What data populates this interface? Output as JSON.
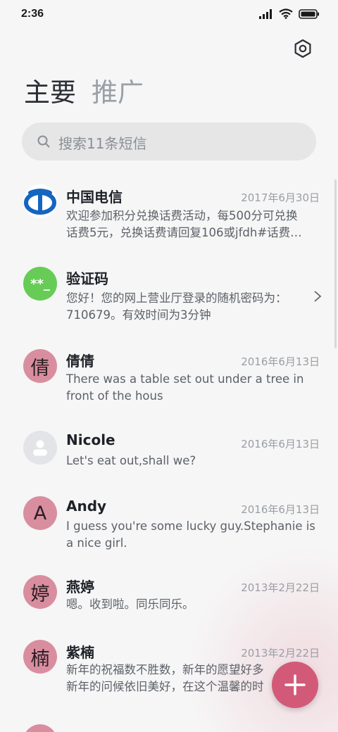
{
  "status_bar": {
    "time": "2:36",
    "icons": [
      "signal-icon",
      "wifi-icon",
      "battery-icon"
    ]
  },
  "header": {
    "settings_icon": "settings-icon",
    "tabs": [
      {
        "label": "主要",
        "active": true
      },
      {
        "label": "推广",
        "active": false
      }
    ]
  },
  "search": {
    "placeholder": "搜索11条短信",
    "icon": "search-icon"
  },
  "conversations": [
    {
      "name": "中国电信",
      "date": "2017年6月30日",
      "preview": [
        "欢迎参加积分兑换话费活动，每500分可兑换",
        "话费5元，兑换话费请回复106或jfdh#话费…"
      ],
      "avatar_type": "logo",
      "avatar_color": "#1565c0"
    },
    {
      "name": "验证码",
      "date": "",
      "preview": [
        "您好！您的网上营业厅登录的随机密码为：",
        "710679。有效时间为3分钟"
      ],
      "avatar_type": "code",
      "avatar_text": "**_",
      "avatar_color": "#66cc55"
    },
    {
      "name": "倩倩",
      "date": "2016年6月13日",
      "preview": [
        "There was a table set out under a tree in",
        "front of the hous"
      ],
      "avatar_text": "倩",
      "avatar_color": "#d98ea0"
    },
    {
      "name": "Nicole",
      "date": "2016年6月13日",
      "preview": [
        "Let's eat out,shall we?"
      ],
      "avatar_type": "person",
      "avatar_color": "#e3e4e7"
    },
    {
      "name": "Andy",
      "date": "2016年6月13日",
      "preview": [
        "I guess you're some lucky guy.Stephanie is",
        "a nice girl."
      ],
      "avatar_text": "A",
      "avatar_color": "#d98ea0"
    },
    {
      "name": "燕婷",
      "date": "2013年2月22日",
      "preview": [
        "嗯。收到啦。同乐同乐。"
      ],
      "avatar_text": "婷",
      "avatar_color": "#d98ea0"
    },
    {
      "name": "紫楠",
      "date": "2013年2月22日",
      "preview": [
        "新年的祝福数不胜数，新年的愿望好多",
        "新年的问候依旧美好，在这个温馨的时"
      ],
      "avatar_text": "楠",
      "avatar_color": "#d98ea0"
    }
  ],
  "fab": {
    "icon": "plus-icon",
    "color": "#d25a78"
  }
}
